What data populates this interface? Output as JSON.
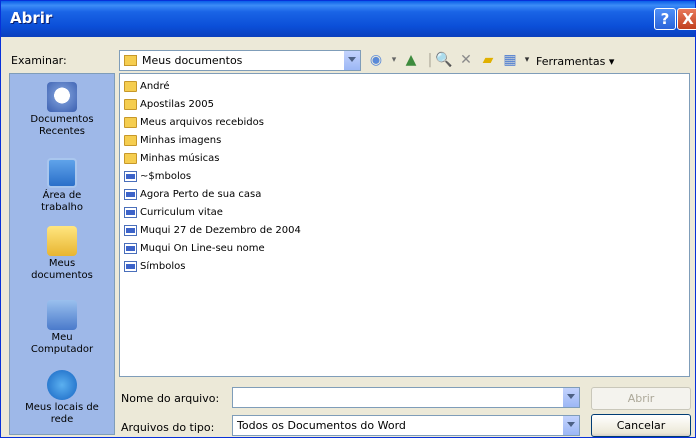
{
  "window": {
    "title": "Abrir",
    "help_label": "?",
    "close_label": "X"
  },
  "toolbar": {
    "look_in_label": "Examinar:",
    "look_in_value": "Meus documentos",
    "tools_label": "Ferramentas"
  },
  "places": [
    {
      "label": "Documentos\nRecentes",
      "icon": "recent-docs-icon"
    },
    {
      "label": "Área de\ntrabalho",
      "icon": "desktop-icon"
    },
    {
      "label": "Meus\ndocumentos",
      "icon": "my-documents-icon"
    },
    {
      "label": "Meu\nComputador",
      "icon": "my-computer-icon"
    },
    {
      "label": "Meus locais de\nrede",
      "icon": "network-icon"
    }
  ],
  "files": [
    {
      "name": "André",
      "type": "folder"
    },
    {
      "name": "Apostilas 2005",
      "type": "folder"
    },
    {
      "name": "Meus arquivos recebidos",
      "type": "folder"
    },
    {
      "name": "Minhas imagens",
      "type": "folder"
    },
    {
      "name": "Minhas músicas",
      "type": "folder"
    },
    {
      "name": "~$mbolos",
      "type": "doc"
    },
    {
      "name": "Agora Perto de sua casa",
      "type": "doc"
    },
    {
      "name": "Curriculum vitae",
      "type": "doc"
    },
    {
      "name": "Muqui 27 de Dezembro de 2004",
      "type": "doc"
    },
    {
      "name": "Muqui On Line-seu nome",
      "type": "doc"
    },
    {
      "name": "Símbolos",
      "type": "doc"
    }
  ],
  "footer": {
    "filename_label": "Nome do arquivo:",
    "filename_value": "",
    "filetype_label": "Arquivos do tipo:",
    "filetype_value": "Todos os Documentos do Word",
    "open_label": "Abrir",
    "cancel_label": "Cancelar"
  }
}
